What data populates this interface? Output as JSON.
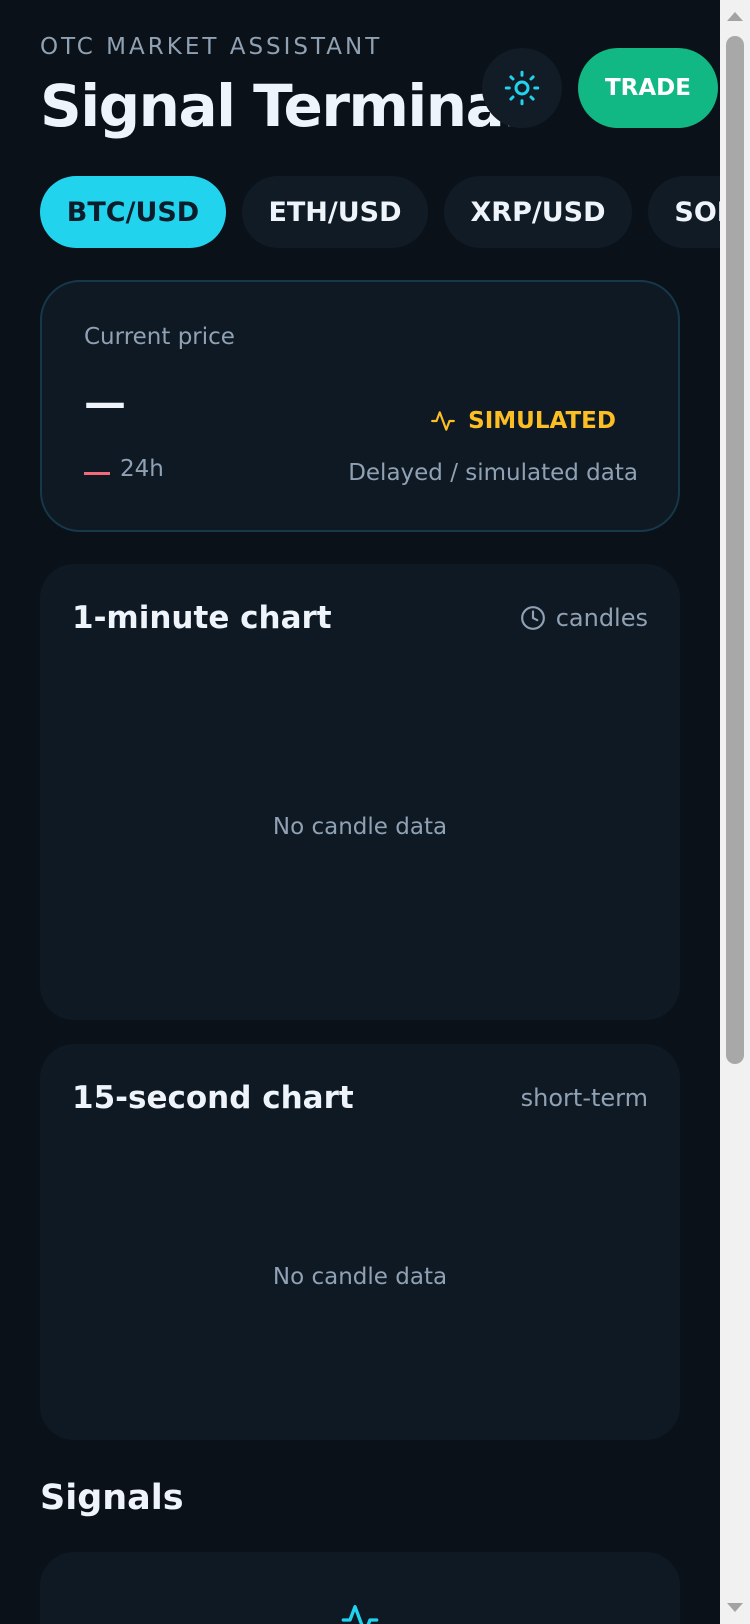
{
  "header": {
    "eyebrow": "OTC MARKET ASSISTANT",
    "title": "Signal Terminal",
    "theme_icon": "sun-icon",
    "trade_label": "TRADE"
  },
  "pairs": [
    {
      "label": "BTC/USD",
      "active": true
    },
    {
      "label": "ETH/USD",
      "active": false
    },
    {
      "label": "XRP/USD",
      "active": false
    },
    {
      "label": "SOL/USD",
      "active": false
    }
  ],
  "price_card": {
    "label": "Current price",
    "value": "—",
    "change_period": "24h",
    "badge": "SIMULATED",
    "badge_icon": "activity-icon",
    "note": "Delayed / simulated data"
  },
  "charts": [
    {
      "title": "1-minute chart",
      "meta": "candles",
      "meta_icon": "clock-icon",
      "empty_text": "No candle data"
    },
    {
      "title": "15-second chart",
      "meta": "short-term",
      "empty_text": "No candle data"
    }
  ],
  "signals": {
    "title": "Signals",
    "icon": "activity-icon"
  },
  "colors": {
    "background": "#0a1118",
    "card": "#0e1924",
    "accent": "#22d3ee",
    "trade": "#12b883",
    "warning": "#fbbf24",
    "negative": "#f06a7a",
    "muted_text": "#8fa1b3"
  }
}
